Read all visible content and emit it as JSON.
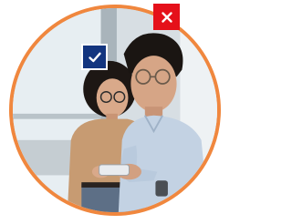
{
  "image": {
    "description_icon": "two-people-looking-at-phone-photo",
    "ring_color": "#f0873e"
  },
  "badges": {
    "check": {
      "icon": "check-icon",
      "color": "#13357f"
    },
    "cross": {
      "icon": "close-icon",
      "color": "#e5101a"
    }
  }
}
